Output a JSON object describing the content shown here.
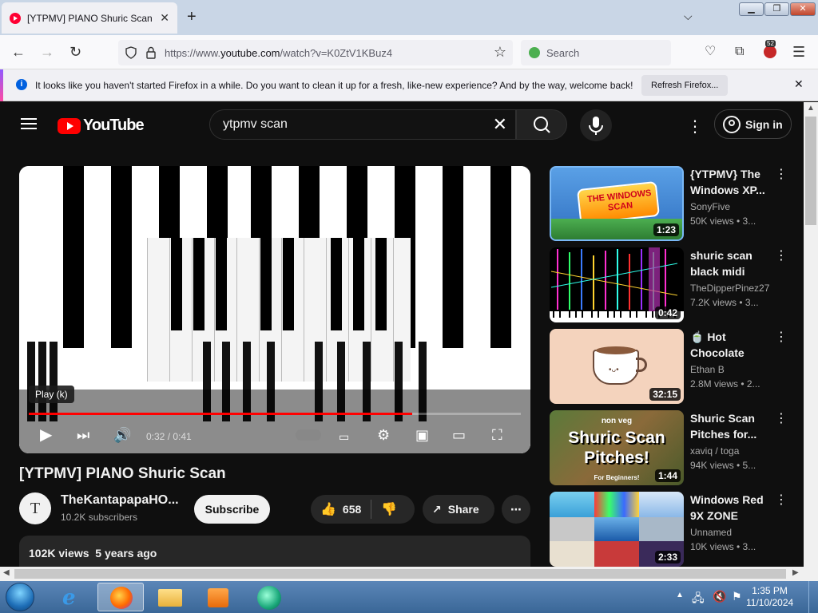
{
  "browser": {
    "tab_title": "[YTPMV] PIANO Shuric Scan - Y",
    "url_prefix": "https://www.",
    "url_domain": "youtube.com",
    "url_path": "/watch?v=K0ZtV1KBuz4",
    "search_placeholder": "Search",
    "extensions_badge": "52",
    "notification": {
      "message": "It looks like you haven't started Firefox in a while. Do you want to clean it up for a fresh, like-new experience? And by the way, welcome back!",
      "button": "Refresh Firefox..."
    }
  },
  "youtube": {
    "logo_text": "YouTube",
    "search_query": "ytpmv scan",
    "signin_label": "Sign in",
    "player": {
      "tooltip": "Play (k)",
      "time": "0:32 / 0:41",
      "progress": 0.78
    },
    "video": {
      "title": "[YTPMV] PIANO Shuric Scan",
      "channel_initial": "T",
      "channel": "TheKantapapaHO...",
      "subscribers": "10.2K subscribers",
      "subscribe_label": "Subscribe",
      "likes": "658",
      "share_label": "Share",
      "views": "102K views",
      "age": "5 years ago"
    },
    "recommendations": [
      {
        "title": "{YTPMV} The Windows XP...",
        "channel": "SonyFive",
        "meta": "50K views • 3...",
        "duration": "1:23",
        "thumb_text": "THE WINDOWS SCAN"
      },
      {
        "title": "shuric scan black midi",
        "channel": "TheDipperPinez27",
        "meta": "7.2K views • 3...",
        "duration": "0:42"
      },
      {
        "title": "🍵 Hot Chocolate [lof...",
        "channel": "Ethan B",
        "meta": "2.8M views • 2...",
        "duration": "32:15"
      },
      {
        "title": "Shuric Scan Pitches for...",
        "channel": "xaviq / toga",
        "meta": "94K views • 5...",
        "duration": "1:44",
        "thumb_text": "Shuric Scan Pitches!",
        "thumb_top": "non veg",
        "thumb_bottom": "For Beginners!"
      },
      {
        "title": "Windows Red 9X ZONE",
        "channel": "Unnamed",
        "meta": "10K views • 3...",
        "duration": "2:33"
      }
    ]
  },
  "taskbar": {
    "time": "1:35 PM",
    "date": "11/10/2024"
  },
  "colors": {
    "yt_red": "#ff0000",
    "progress_red": "#ff0000",
    "yt_bg": "#0f0f0f"
  }
}
